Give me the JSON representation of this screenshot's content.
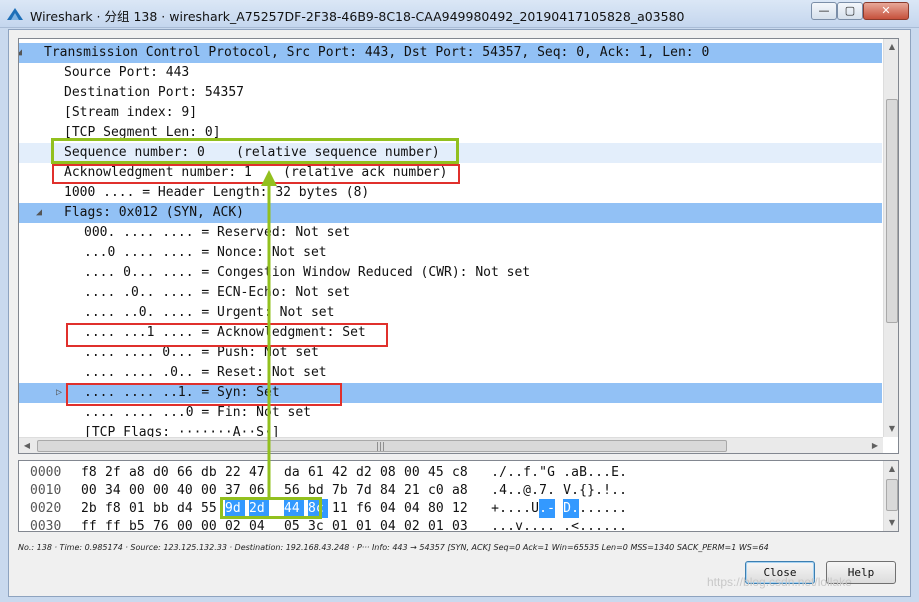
{
  "window": {
    "title": "Wireshark · 分组 138 · wireshark_A75257DF-2F38-46B9-8C18-CAA949980492_20190417105828_a03580",
    "minimize_symbol": "—",
    "maximize_symbol": "▢",
    "close_symbol": "✕"
  },
  "tree": {
    "rows": [
      {
        "text": "Transmission Control Protocol, Src Port: 443, Dst Port: 54357, Seq: 0, Ack: 1, Len: 0",
        "expander": "◢"
      },
      {
        "text": "Source Port: 443"
      },
      {
        "text": "Destination Port: 54357"
      },
      {
        "text": "[Stream index: 9]"
      },
      {
        "text": "[TCP Segment Len: 0]"
      },
      {
        "text": "Sequence number: 0    (relative sequence number)"
      },
      {
        "text": "Acknowledgment number: 1    (relative ack number)"
      },
      {
        "text": "1000 .... = Header Length: 32 bytes (8)"
      },
      {
        "text": "Flags: 0x012 (SYN, ACK)",
        "expander": "◢"
      },
      {
        "text": "000. .... .... = Reserved: Not set"
      },
      {
        "text": "...0 .... .... = Nonce: Not set"
      },
      {
        "text": ".... 0... .... = Congestion Window Reduced (CWR): Not set"
      },
      {
        "text": ".... .0.. .... = ECN-Echo: Not set"
      },
      {
        "text": ".... ..0. .... = Urgent: Not set"
      },
      {
        "text": ".... ...1 .... = Acknowledgment: Set"
      },
      {
        "text": ".... .... 0... = Push: Not set"
      },
      {
        "text": ".... .... .0.. = Reset: Not set"
      },
      {
        "text": ".... .... ..1. = Syn: Set",
        "expander": "▷"
      },
      {
        "text": ".... .... ...0 = Fin: Not set"
      },
      {
        "text": "[TCP Flags: ·······A··S·]"
      }
    ],
    "hscroll_grip": "|||"
  },
  "hex": {
    "rows": [
      {
        "offset": "0000",
        "bytes": [
          "f8",
          "2f",
          "a8",
          "d0",
          "66",
          "db",
          "22",
          "47",
          "da",
          "61",
          "42",
          "d2",
          "08",
          "00",
          "45",
          "c8"
        ],
        "ascii": "./..f.\"G .aB...E."
      },
      {
        "offset": "0010",
        "bytes": [
          "00",
          "34",
          "00",
          "00",
          "40",
          "00",
          "37",
          "06",
          "56",
          "bd",
          "7b",
          "7d",
          "84",
          "21",
          "c0",
          "a8"
        ],
        "ascii": ".4..@.7. V.{}.!.."
      },
      {
        "offset": "0020",
        "bytes": [
          "2b",
          "f8",
          "01",
          "bb",
          "d4",
          "55",
          "9d",
          "2d",
          "44",
          "8c",
          "11",
          "f6",
          "04",
          "04",
          "80",
          "12"
        ],
        "ascii": "+....U.- D.......",
        "selected_bytes": [
          6,
          7,
          8,
          9
        ]
      },
      {
        "offset": "0030",
        "bytes": [
          "ff",
          "ff",
          "b5",
          "76",
          "00",
          "00",
          "02",
          "04",
          "05",
          "3c",
          "01",
          "01",
          "04",
          "02",
          "01",
          "03"
        ],
        "ascii": "...v.... .<......"
      }
    ]
  },
  "status_bar": "No.: 138 · Time: 0.985174 · Source: 123.125.132.33 · Destination: 192.168.43.248 · P··· Info: 443 → 54357 [SYN, ACK] Seq=0 Ack=1 Win=65535 Len=0 MSS=1340 SACK_PERM=1 WS=64",
  "buttons": {
    "close": "Close",
    "help": "Help"
  },
  "watermark": "https://blog.csdn.net/lollake",
  "colors": {
    "highlight": "#92c1f5",
    "selection": "#3399ff",
    "annotation_green": "#92c01e",
    "annotation_red": "#e0302c"
  }
}
